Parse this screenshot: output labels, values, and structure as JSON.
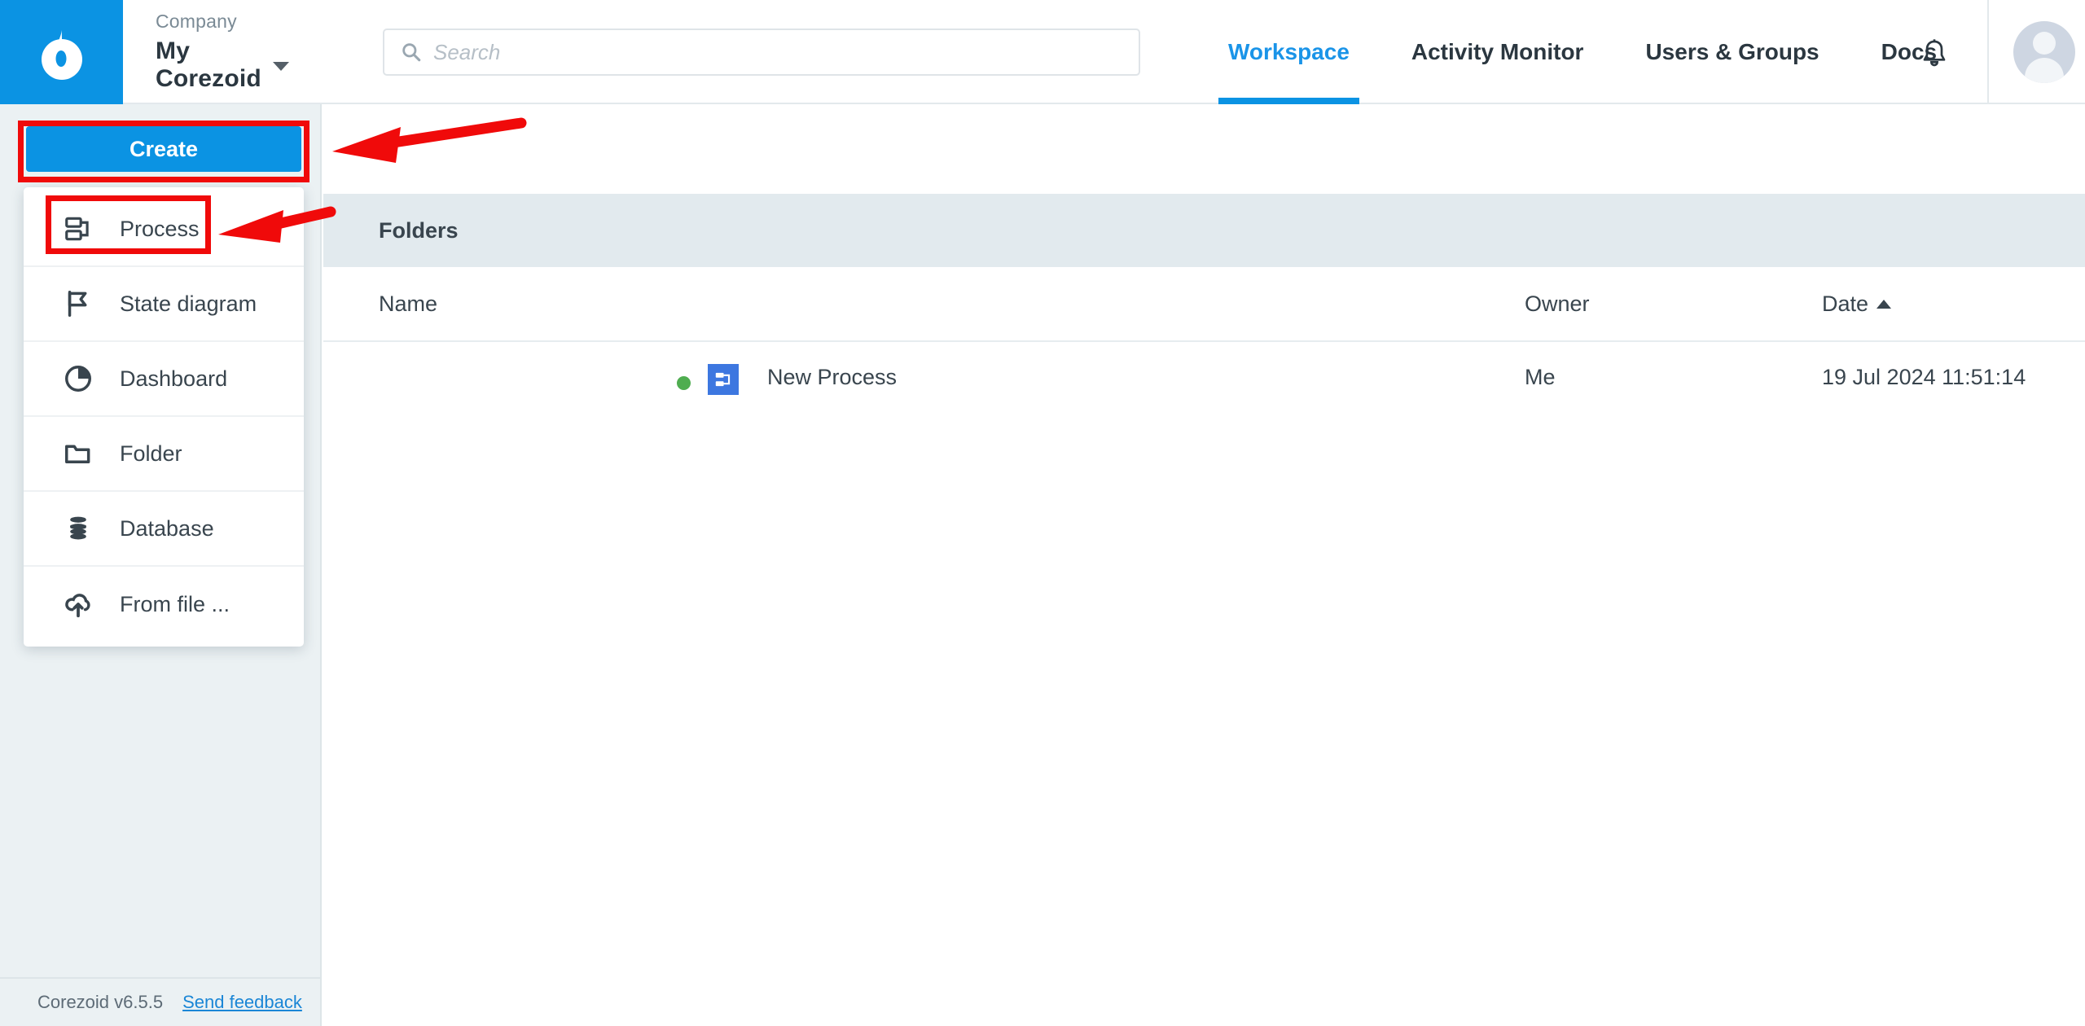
{
  "header": {
    "logo_icon": "corezoid-drop-logo",
    "company_label": "Company",
    "company_name": "My Corezoid",
    "company_caret_icon": "chevron-down-icon",
    "search": {
      "icon": "search-icon",
      "placeholder": "Search",
      "value": ""
    },
    "nav": [
      {
        "label": "Workspace",
        "active": true
      },
      {
        "label": "Activity Monitor",
        "active": false
      },
      {
        "label": "Users & Groups",
        "active": false
      },
      {
        "label": "Docs",
        "active": false
      }
    ],
    "bell_icon": "notification-bell-icon",
    "avatar_icon": "user-avatar"
  },
  "sidebar": {
    "create_label": "Create",
    "footer": {
      "version": "Corezoid v6.5.5",
      "feedback_link": "Send feedback"
    }
  },
  "create_menu": {
    "items": [
      {
        "label": "Process",
        "icon": "process-icon"
      },
      {
        "label": "State diagram",
        "icon": "flag-icon"
      },
      {
        "label": "Dashboard",
        "icon": "pie-chart-icon"
      },
      {
        "label": "Folder",
        "icon": "folder-icon"
      },
      {
        "label": "Database",
        "icon": "database-icon"
      },
      {
        "label": "From file ...",
        "icon": "cloud-upload-icon"
      }
    ]
  },
  "main": {
    "section_title": "Folders",
    "columns": {
      "name": "Name",
      "owner": "Owner",
      "date": "Date",
      "date_sort": "ascending"
    },
    "rows": [
      {
        "status": "active",
        "icon": "process-icon",
        "name": "New Process",
        "owner": "Me",
        "date": "19 Jul 2024 11:51:14"
      }
    ]
  },
  "annotations": {
    "highlight_create": "Create button highlighted",
    "highlight_process": "Process menu item highlighted",
    "arrow_to_create": "red arrow pointing to Create button",
    "arrow_to_process": "red arrow pointing to Process menu item"
  },
  "colors": {
    "brand_blue": "#0b93e3",
    "nav_active": "#1a94e8",
    "sidebar_bg": "#ebf1f3",
    "band_bg": "#e2eaee",
    "status_green": "#4fad50",
    "annotation_red": "#f00a0a",
    "process_icon_blue": "#3d77e0"
  }
}
